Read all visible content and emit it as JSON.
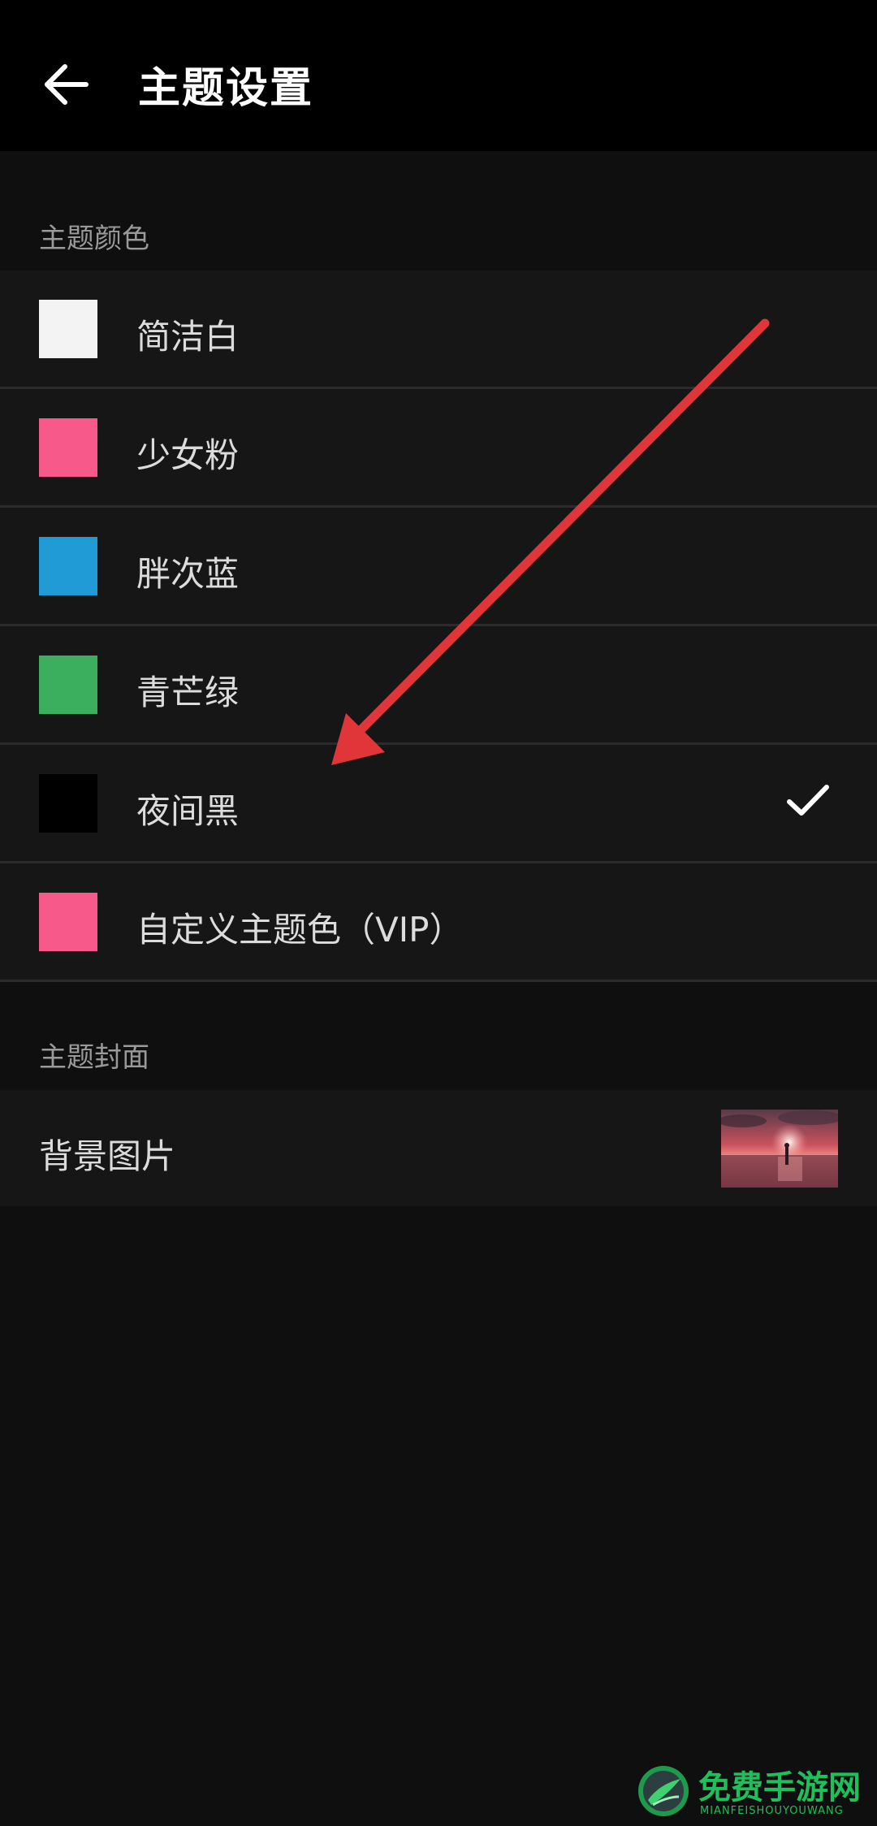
{
  "header": {
    "title": "主题设置",
    "back_icon": "arrow-left-icon"
  },
  "theme_colors": {
    "section_title": "主题颜色",
    "selected": "夜间黑",
    "items": [
      {
        "label": "简洁白",
        "color": "#f3f3f3",
        "selected": false
      },
      {
        "label": "少女粉",
        "color": "#f75a8a",
        "selected": false
      },
      {
        "label": "胖次蓝",
        "color": "#219bd6",
        "selected": false
      },
      {
        "label": "青芒绿",
        "color": "#3caf5f",
        "selected": false
      },
      {
        "label": "夜间黑",
        "color": "#000000",
        "selected": true
      },
      {
        "label": "自定义主题色（VIP）",
        "color": "#f75a8a",
        "selected": false
      }
    ]
  },
  "theme_cover": {
    "section_title": "主题封面",
    "background_label": "背景图片"
  },
  "colors": {
    "accent_arrow": "#e0363a",
    "check": "#ffffff",
    "watermark": "#1fbf5b"
  },
  "watermark": {
    "title": "免费手游网",
    "subtitle": "MIANFEISHOUYOUWANG"
  }
}
